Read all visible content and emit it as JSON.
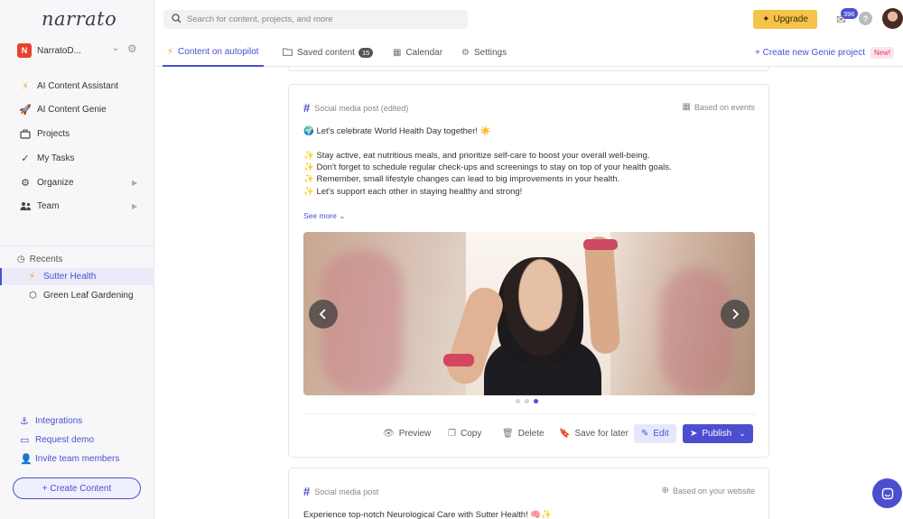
{
  "app": {
    "logo": "narrato"
  },
  "workspace": {
    "badge": "N",
    "name": "NarratoD..."
  },
  "sidebar": {
    "nav": [
      {
        "label": "AI Content Assistant",
        "icon": "bolt-icon"
      },
      {
        "label": "AI Content Genie",
        "icon": "rocket-icon"
      },
      {
        "label": "Projects",
        "icon": "briefcase-icon"
      },
      {
        "label": "My Tasks",
        "icon": "checkmark-icon"
      },
      {
        "label": "Organize",
        "icon": "organize-icon"
      },
      {
        "label": "Team",
        "icon": "team-icon"
      }
    ],
    "recents_label": "Recents",
    "recents": [
      {
        "label": "Sutter Health",
        "icon": "bolt-icon"
      },
      {
        "label": "Green Leaf Gardening",
        "icon": "cube-icon"
      }
    ],
    "bottom_links": [
      {
        "label": "Integrations",
        "icon": "anchor-icon"
      },
      {
        "label": "Request demo",
        "icon": "monitor-icon"
      },
      {
        "label": "Invite team members",
        "icon": "add-user-icon"
      }
    ],
    "create_button": "+ Create Content"
  },
  "topbar": {
    "search_placeholder": "Search for content, projects, and more",
    "upgrade_label": "Upgrade",
    "mail_count": "396",
    "help": "?"
  },
  "tabs": {
    "items": [
      {
        "label": "Content on autopilot"
      },
      {
        "label": "Saved content",
        "count": "15"
      },
      {
        "label": "Calendar"
      },
      {
        "label": "Settings"
      }
    ],
    "create_project": "+ Create new Genie project",
    "new_badge": "New!"
  },
  "cards": [
    {
      "type": "Social media post (edited)",
      "source": "Based on events",
      "lines": [
        "🌍 Let's celebrate World Health Day together! ☀️",
        "✨ Stay active, eat nutritious meals, and prioritize self-care to boost your overall well-being.",
        "✨ Don't forget to schedule regular check-ups and screenings to stay on top of your health goals.",
        "✨ Remember, small lifestyle changes can lead to big improvements in your health.",
        "✨ Let's support each other in staying healthy and strong!"
      ],
      "see_more": "See more ⌄",
      "actions": {
        "preview": "Preview",
        "copy": "Copy",
        "delete": "Delete",
        "save": "Save for later",
        "edit": "Edit",
        "publish": "Publish"
      }
    },
    {
      "type": "Social media post",
      "source": "Based on your website",
      "lines": [
        "Experience top-notch Neurological Care with Sutter Health! 🧠✨"
      ]
    }
  ]
}
